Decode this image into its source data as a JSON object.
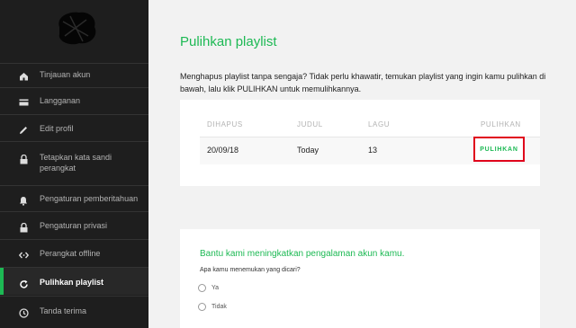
{
  "sidebar": {
    "items": [
      {
        "label": "Tinjauan akun",
        "icon": "home-icon"
      },
      {
        "label": "Langganan",
        "icon": "card-icon"
      },
      {
        "label": "Edit profil",
        "icon": "pencil-icon"
      },
      {
        "label": "Tetapkan kata sandi perangkat",
        "icon": "lock-icon"
      },
      {
        "label": "Pengaturan pemberitahuan",
        "icon": "bell-icon"
      },
      {
        "label": "Pengaturan privasi",
        "icon": "lock-icon"
      },
      {
        "label": "Perangkat offline",
        "icon": "code-icon"
      },
      {
        "label": "Pulihkan playlist",
        "icon": "refresh-icon",
        "active": true
      },
      {
        "label": "Tanda terima",
        "icon": "clock-icon"
      }
    ]
  },
  "main": {
    "title": "Pulihkan playlist",
    "intro": "Menghapus playlist tanpa sengaja? Tidak perlu khawatir, temukan playlist yang ingin kamu pulihkan di bawah, lalu klik PULIHKAN untuk memulihkannya.",
    "table": {
      "headers": [
        "DIHAPUS",
        "JUDUL",
        "LAGU",
        "PULIHKAN"
      ],
      "rows": [
        {
          "deleted": "20/09/18",
          "title": "Today",
          "songs": "13",
          "action": "PULIHKAN"
        }
      ]
    },
    "feedback": {
      "title": "Bantu kami meningkatkan pengalaman akun kamu.",
      "question": "Apa kamu menemukan yang dicari?",
      "options": [
        "Ya",
        "Tidak"
      ]
    }
  },
  "colors": {
    "accent": "#1db954",
    "sidebar_bg": "#1e1e1e",
    "page_bg": "#f2f2f2",
    "highlight_border": "#e0001b"
  }
}
